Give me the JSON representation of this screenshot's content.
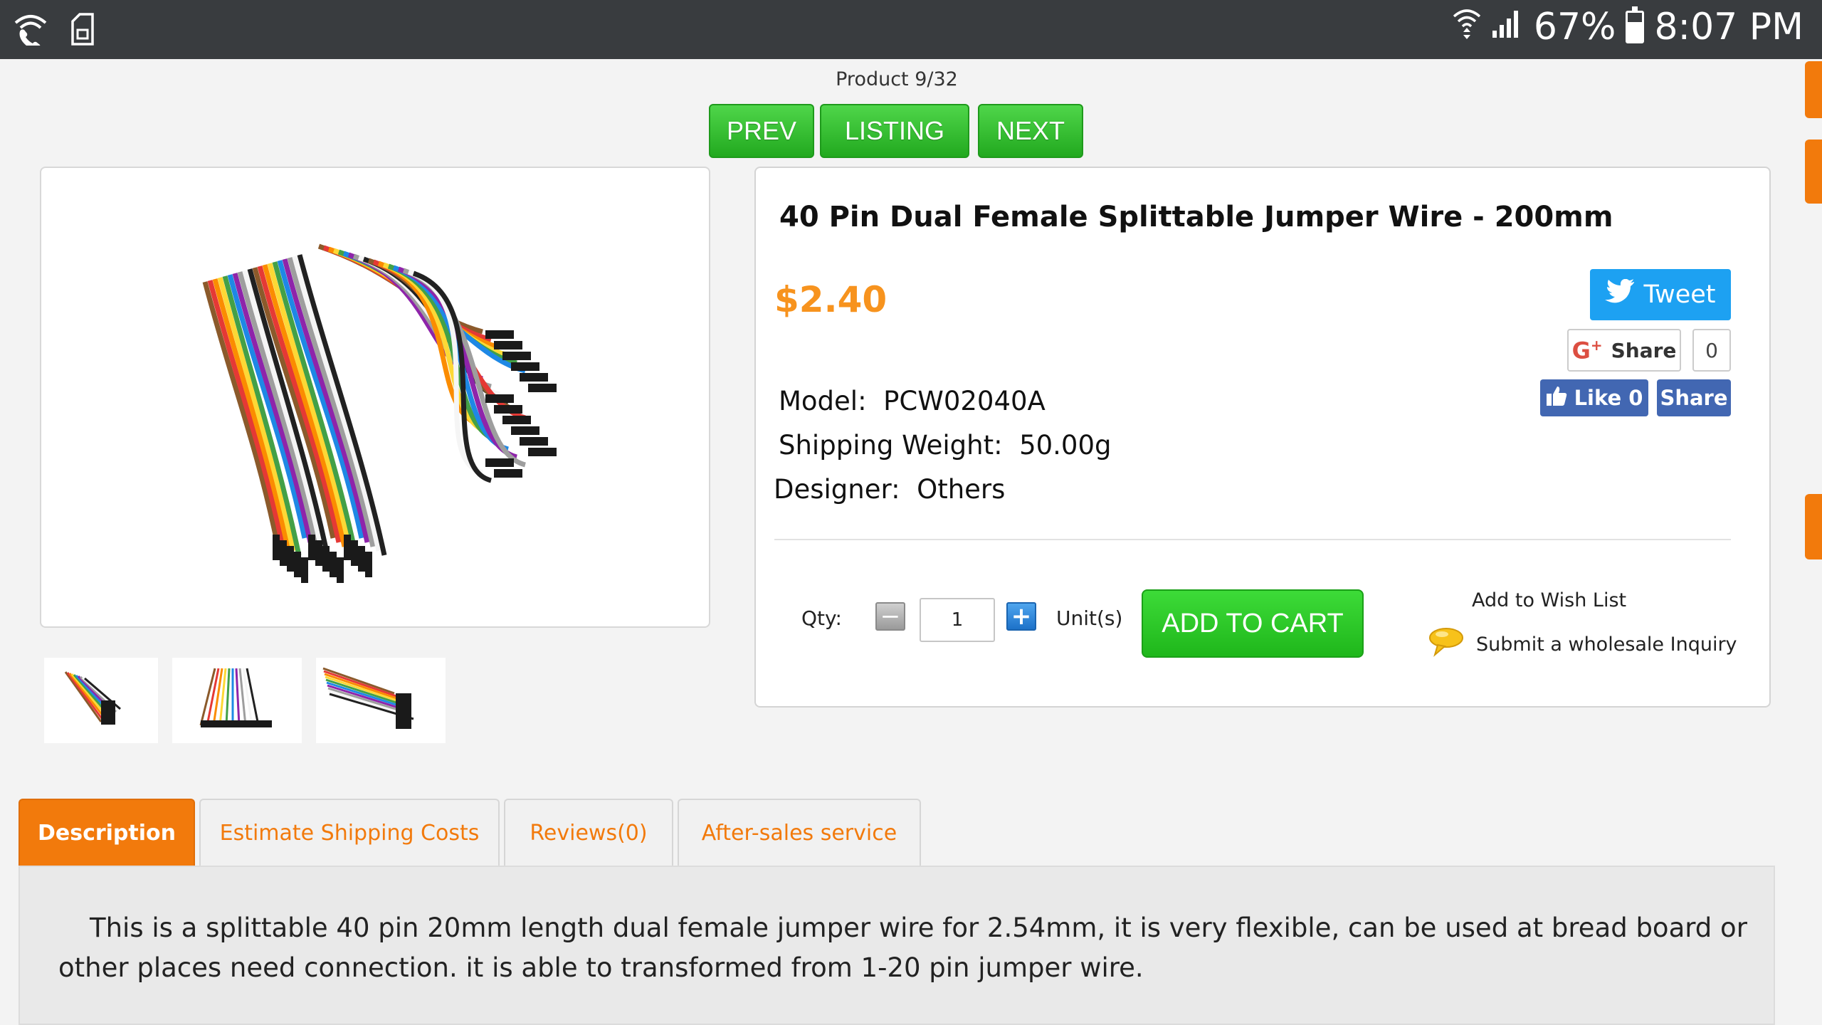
{
  "status_bar": {
    "battery": "67%",
    "time": "8:07 PM",
    "battery_level": 0.67
  },
  "nav": {
    "product_count": "Product 9/32",
    "prev_label": "PREV",
    "listing_label": "LISTING",
    "next_label": "NEXT"
  },
  "product": {
    "title": "40 Pin Dual Female Splittable Jumper Wire - 200mm",
    "price": "$2.40",
    "specs": [
      {
        "label": "Model:",
        "value": "PCW02040A"
      },
      {
        "label": "Shipping Weight:",
        "value": "50.00g"
      },
      {
        "label": "Designer:",
        "value": "Others"
      }
    ]
  },
  "social": {
    "tweet_label": "Tweet",
    "gplus_label": "Share",
    "gplus_count": "0",
    "fb_like_label": "Like 0",
    "fb_share_label": "Share"
  },
  "cart": {
    "qty_label": "Qty:",
    "qty_value": "1",
    "unit_label": "Unit(s)",
    "add_to_cart_label": "ADD TO CART",
    "wish_list_label": "Add to Wish List",
    "inquiry_label": "Submit a wholesale Inquiry"
  },
  "tabs": [
    {
      "label": "Description",
      "active": true
    },
    {
      "label": "Estimate Shipping Costs",
      "active": false
    },
    {
      "label": "Reviews(0)",
      "active": false
    },
    {
      "label": "After-sales service",
      "active": false
    }
  ],
  "description": "This is a splittable 40 pin 20mm length dual female jumper wire for 2.54mm, it is very flexible, can be used at bread board or other places need connection. it is able to transformed from 1-20 pin jumper wire.",
  "colors": {
    "accent_orange": "#f27a0c",
    "price_orange": "#f7931e",
    "button_green": "#22a91f",
    "twitter_blue": "#1da1f2",
    "facebook_blue": "#4267b2"
  },
  "icons": [
    "wifi-call-icon",
    "sim-icon",
    "wifi-icon",
    "signal-icon",
    "battery-icon",
    "twitter-bird-icon",
    "google-plus-icon",
    "thumbs-up-icon",
    "minus-icon",
    "plus-icon",
    "speech-bubble-icon"
  ]
}
